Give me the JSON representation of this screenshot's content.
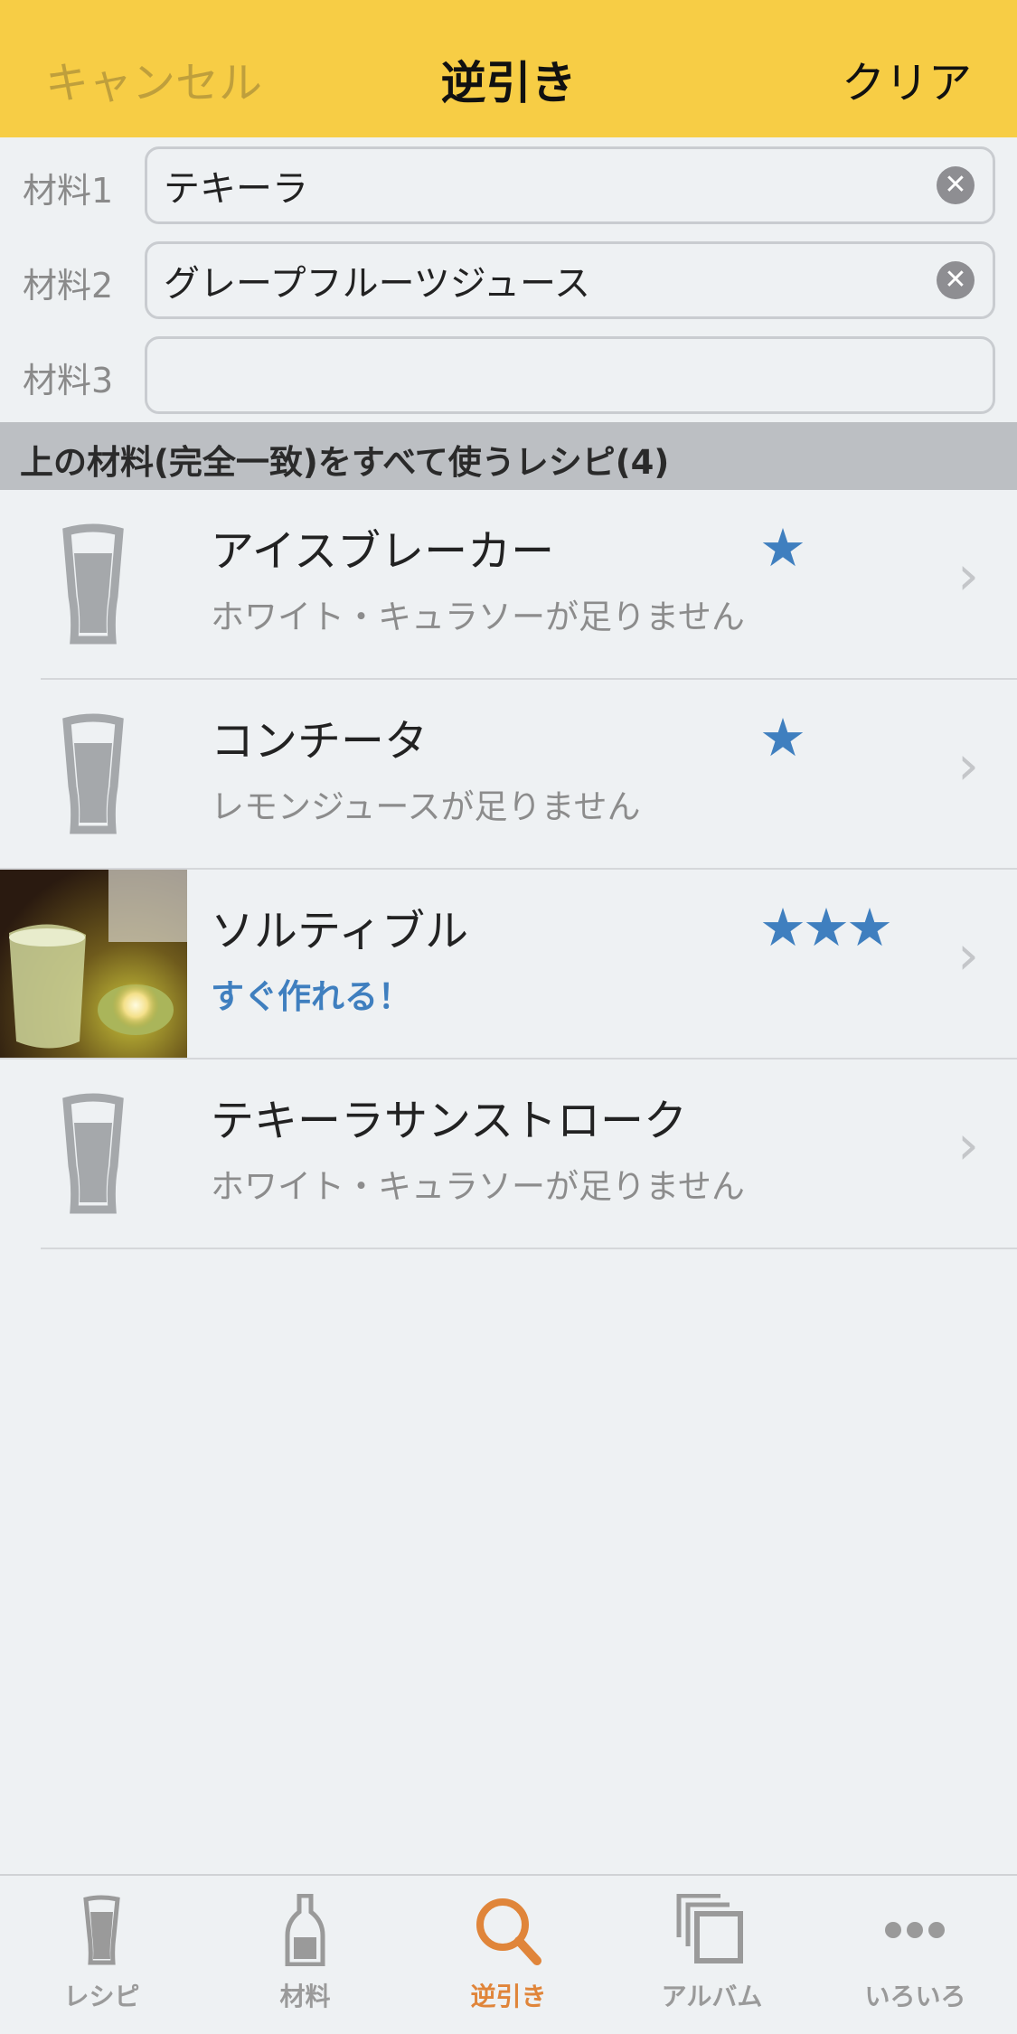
{
  "navbar": {
    "cancel": "キャンセル",
    "title": "逆引き",
    "clear": "クリア"
  },
  "ingredients": [
    {
      "label": "材料1",
      "value": "テキーラ"
    },
    {
      "label": "材料2",
      "value": "グレープフルーツジュース"
    },
    {
      "label": "材料3",
      "value": ""
    }
  ],
  "section_header": "上の材料(完全一致)をすべて使うレシピ(4)",
  "recipes": [
    {
      "name": "アイスブレーカー",
      "status": "ホワイト・キュラソーが足りません",
      "stars": "★",
      "rating": 1
    },
    {
      "name": "コンチータ",
      "status": "レモンジュースが足りません",
      "stars": "★",
      "rating": 1
    },
    {
      "name": "ソルティブル",
      "status": "すぐ作れる！",
      "stars": "★★★",
      "rating": 3
    },
    {
      "name": "テキーラサンストローク",
      "status": "ホワイト・キュラソーが足りません",
      "stars": "",
      "rating": 0
    }
  ],
  "tabs": [
    {
      "label": "レシピ",
      "icon": "glass-icon"
    },
    {
      "label": "材料",
      "icon": "bottle-icon"
    },
    {
      "label": "逆引き",
      "icon": "search-icon"
    },
    {
      "label": "アルバム",
      "icon": "album-icon"
    },
    {
      "label": "いろいろ",
      "icon": "more-icon"
    }
  ],
  "colors": {
    "navbar": "#f7cd45",
    "accent": "#3f7fbf",
    "active_tab": "#e0853a"
  }
}
